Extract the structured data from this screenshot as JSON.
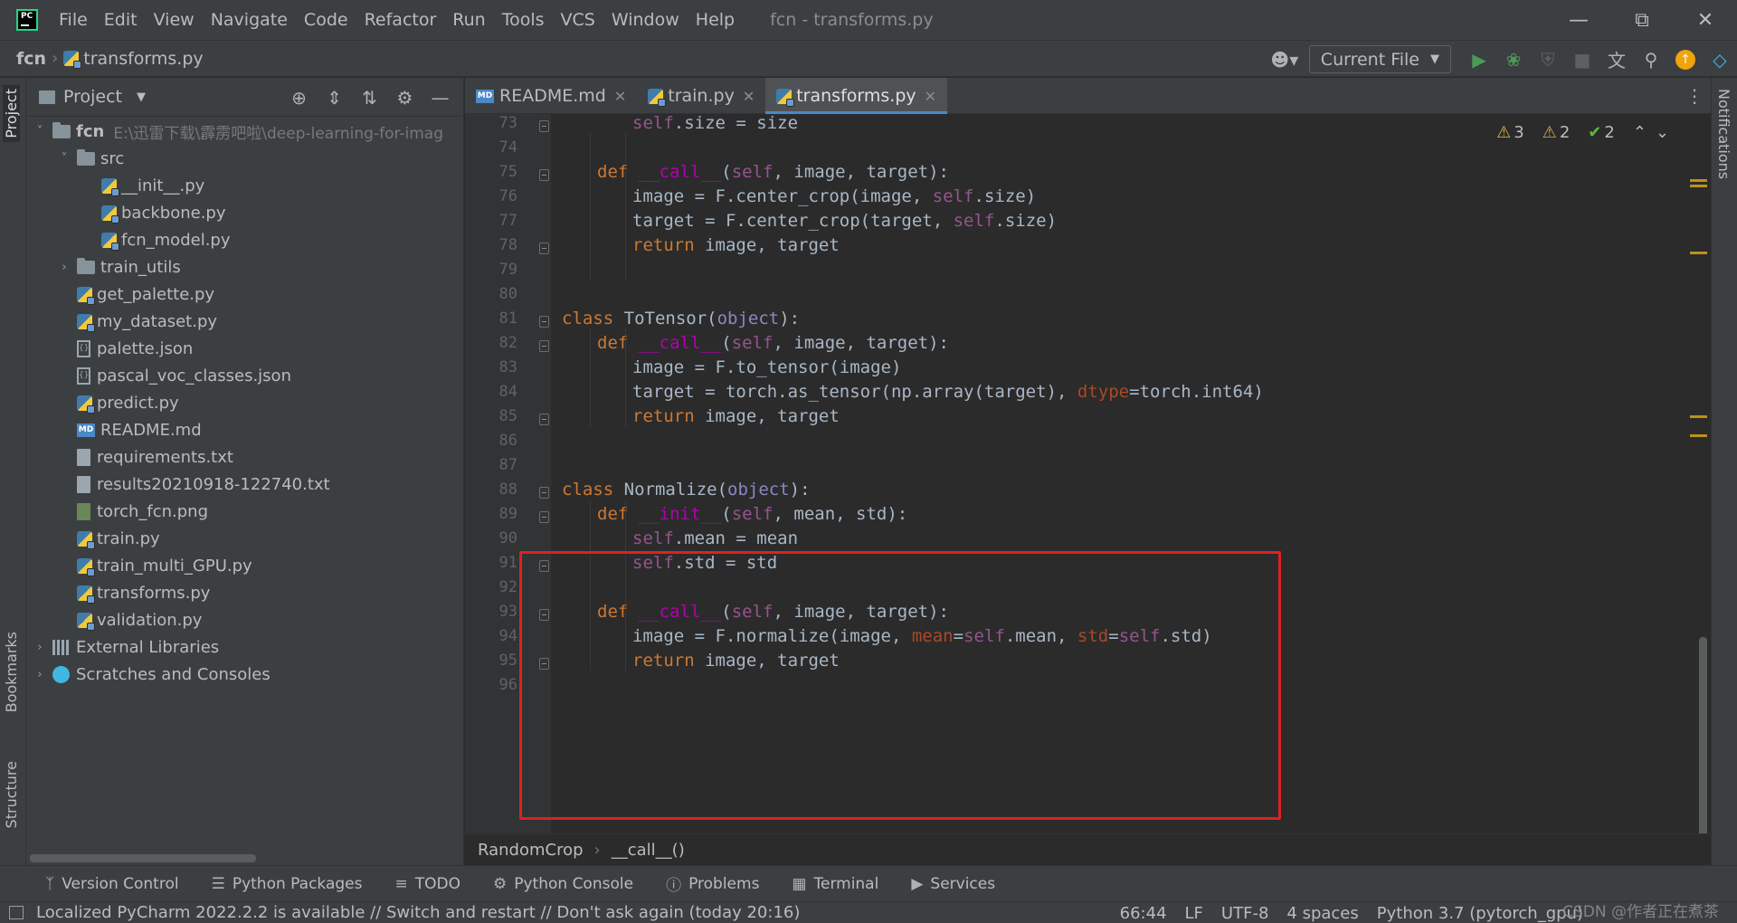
{
  "menubar": {
    "items": [
      "File",
      "Edit",
      "View",
      "Navigate",
      "Code",
      "Refactor",
      "Run",
      "Tools",
      "VCS",
      "Window",
      "Help"
    ],
    "title": "fcn - transforms.py",
    "window_controls": [
      "minimize-icon",
      "restore-icon",
      "close-icon"
    ]
  },
  "navbar": {
    "project": "fcn",
    "file": "transforms.py",
    "run_config": "Current File"
  },
  "left_strip": {
    "project": "Project",
    "bookmarks": "Bookmarks",
    "structure": "Structure"
  },
  "right_strip": {
    "notifications": "Notifications"
  },
  "project_panel": {
    "title": "Project",
    "tree": [
      {
        "label": "fcn",
        "path": "E:\\迅雷下载\\霹雳吧啦\\deep-learning-for-imag",
        "type": "folder",
        "expanded": true,
        "level": 0
      },
      {
        "label": "src",
        "type": "folder",
        "expanded": true,
        "level": 1
      },
      {
        "label": "__init__.py",
        "type": "python",
        "level": 2
      },
      {
        "label": "backbone.py",
        "type": "python",
        "level": 2
      },
      {
        "label": "fcn_model.py",
        "type": "python",
        "level": 2
      },
      {
        "label": "train_utils",
        "type": "folder",
        "expanded": false,
        "level": 1
      },
      {
        "label": "get_palette.py",
        "type": "python",
        "level": 1
      },
      {
        "label": "my_dataset.py",
        "type": "python",
        "level": 1
      },
      {
        "label": "palette.json",
        "type": "json",
        "level": 1
      },
      {
        "label": "pascal_voc_classes.json",
        "type": "json",
        "level": 1
      },
      {
        "label": "predict.py",
        "type": "python",
        "level": 1
      },
      {
        "label": "README.md",
        "type": "markdown",
        "level": 1
      },
      {
        "label": "requirements.txt",
        "type": "text",
        "level": 1
      },
      {
        "label": "results20210918-122740.txt",
        "type": "text",
        "level": 1
      },
      {
        "label": "torch_fcn.png",
        "type": "image",
        "level": 1
      },
      {
        "label": "train.py",
        "type": "python",
        "level": 1
      },
      {
        "label": "train_multi_GPU.py",
        "type": "python",
        "level": 1
      },
      {
        "label": "transforms.py",
        "type": "python",
        "level": 1
      },
      {
        "label": "validation.py",
        "type": "python",
        "level": 1
      },
      {
        "label": "External Libraries",
        "type": "library",
        "expanded": false,
        "level": 0
      },
      {
        "label": "Scratches and Consoles",
        "type": "scratch",
        "expanded": false,
        "level": 0
      }
    ]
  },
  "tabs": [
    {
      "label": "README.md",
      "type": "markdown",
      "active": false
    },
    {
      "label": "train.py",
      "type": "python",
      "active": false
    },
    {
      "label": "transforms.py",
      "type": "python",
      "active": true
    }
  ],
  "inspections": {
    "warnings_a": "3",
    "warnings_b": "2",
    "ok": "2"
  },
  "editor": {
    "lines": [
      {
        "n": "73",
        "indent": 2,
        "tokens": [
          [
            "self",
            "self"
          ],
          [
            ".size = size",
            "def"
          ]
        ]
      },
      {
        "n": "74",
        "indent": 0,
        "tokens": []
      },
      {
        "n": "75",
        "indent": 1,
        "tokens": [
          [
            "def ",
            "kw"
          ],
          [
            "__call__",
            "fn"
          ],
          [
            "(",
            "def"
          ],
          [
            "self",
            "self"
          ],
          [
            ", image, target):",
            "def"
          ]
        ]
      },
      {
        "n": "76",
        "indent": 2,
        "tokens": [
          [
            "image = F.center_crop(image, ",
            "def"
          ],
          [
            "self",
            "self"
          ],
          [
            ".size)",
            "def"
          ]
        ]
      },
      {
        "n": "77",
        "indent": 2,
        "tokens": [
          [
            "target = F.center_crop(target, ",
            "def"
          ],
          [
            "self",
            "self"
          ],
          [
            ".size)",
            "def"
          ]
        ]
      },
      {
        "n": "78",
        "indent": 2,
        "tokens": [
          [
            "return ",
            "kw"
          ],
          [
            "image, target",
            "def"
          ]
        ]
      },
      {
        "n": "79",
        "indent": 0,
        "tokens": []
      },
      {
        "n": "80",
        "indent": 0,
        "tokens": []
      },
      {
        "n": "81",
        "indent": 0,
        "tokens": [
          [
            "class ",
            "kw"
          ],
          [
            "ToTensor(",
            "def"
          ],
          [
            "object",
            "builtin"
          ],
          [
            "):",
            "def"
          ]
        ]
      },
      {
        "n": "82",
        "indent": 1,
        "tokens": [
          [
            "def ",
            "kw"
          ],
          [
            "__call__",
            "fn"
          ],
          [
            "(",
            "def"
          ],
          [
            "self",
            "self"
          ],
          [
            ", image, target):",
            "def"
          ]
        ]
      },
      {
        "n": "83",
        "indent": 2,
        "tokens": [
          [
            "image = F.to_tensor(image)",
            "def"
          ]
        ]
      },
      {
        "n": "84",
        "indent": 2,
        "tokens": [
          [
            "target = torch.as_tensor(np.array(target), ",
            "def"
          ],
          [
            "dtype",
            "param"
          ],
          [
            "=torch.int64)",
            "def"
          ]
        ]
      },
      {
        "n": "85",
        "indent": 2,
        "tokens": [
          [
            "return ",
            "kw"
          ],
          [
            "image, target",
            "def"
          ]
        ]
      },
      {
        "n": "86",
        "indent": 0,
        "tokens": []
      },
      {
        "n": "87",
        "indent": 0,
        "tokens": []
      },
      {
        "n": "88",
        "indent": 0,
        "tokens": [
          [
            "class ",
            "kw"
          ],
          [
            "Normalize(",
            "def"
          ],
          [
            "object",
            "builtin"
          ],
          [
            "):",
            "def"
          ]
        ]
      },
      {
        "n": "89",
        "indent": 1,
        "tokens": [
          [
            "def ",
            "kw"
          ],
          [
            "__init__",
            "fn"
          ],
          [
            "(",
            "def"
          ],
          [
            "self",
            "self"
          ],
          [
            ", mean, std):",
            "def"
          ]
        ]
      },
      {
        "n": "90",
        "indent": 2,
        "tokens": [
          [
            "self",
            "self"
          ],
          [
            ".mean = mean",
            "def"
          ]
        ]
      },
      {
        "n": "91",
        "indent": 2,
        "tokens": [
          [
            "self",
            "self"
          ],
          [
            ".std = std",
            "def"
          ]
        ]
      },
      {
        "n": "92",
        "indent": 0,
        "tokens": []
      },
      {
        "n": "93",
        "indent": 1,
        "tokens": [
          [
            "def ",
            "kw"
          ],
          [
            "__call__",
            "fn"
          ],
          [
            "(",
            "def"
          ],
          [
            "self",
            "self"
          ],
          [
            ", image, target):",
            "def"
          ]
        ]
      },
      {
        "n": "94",
        "indent": 2,
        "tokens": [
          [
            "image = F.normalize(image, ",
            "def"
          ],
          [
            "mean",
            "param"
          ],
          [
            "=",
            "def"
          ],
          [
            "self",
            "self"
          ],
          [
            ".mean, ",
            "def"
          ],
          [
            "std",
            "param"
          ],
          [
            "=",
            "def"
          ],
          [
            "self",
            "self"
          ],
          [
            ".std)",
            "def"
          ]
        ]
      },
      {
        "n": "95",
        "indent": 2,
        "tokens": [
          [
            "return ",
            "kw"
          ],
          [
            "image, target",
            "def"
          ]
        ]
      },
      {
        "n": "96",
        "indent": 0,
        "tokens": []
      }
    ]
  },
  "breadcrumbs": {
    "class_name": "RandomCrop",
    "method": "__call__()"
  },
  "tool_windows": [
    "Version Control",
    "Python Packages",
    "TODO",
    "Python Console",
    "Problems",
    "Terminal",
    "Services"
  ],
  "status": {
    "message": "Localized PyCharm 2022.2.2 is available // Switch and restart // Don't ask again (today 20:16)",
    "position": "66:44",
    "line_sep": "LF",
    "encoding": "UTF-8",
    "indent": "4 spaces",
    "interpreter": "Python 3.7 (pytorch_gpu)"
  },
  "watermark": "CSDN @作者正在煮茶",
  "colors": {
    "keyword": "#cc7832",
    "self": "#94558d",
    "dunder": "#b200b2",
    "param": "#aa4926",
    "builtin": "#8888c6",
    "highlight_box": "#e02020",
    "accent": "#4a88c7"
  }
}
